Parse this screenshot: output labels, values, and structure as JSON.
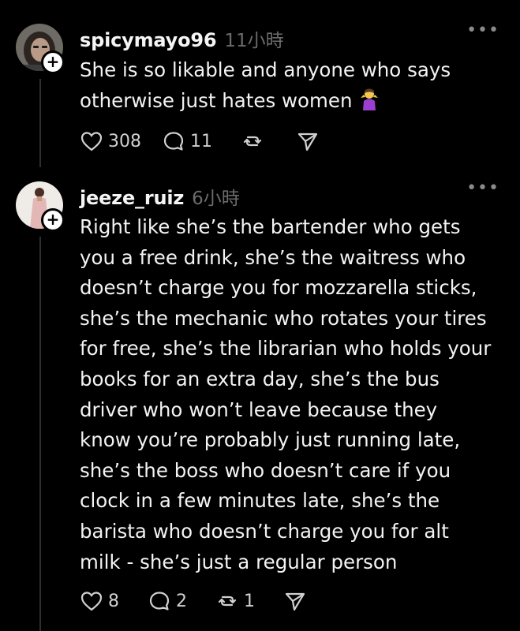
{
  "posts": [
    {
      "username": "spicymayo96",
      "timestamp": "11小時",
      "more_icon": "more-horizontal-icon",
      "text": "She is so likable and anyone who says\notherwise just hates women",
      "emoji": "person-shrugging-emoji",
      "actions": {
        "likes": "308",
        "replies": "11",
        "reposts": "",
        "share": ""
      }
    },
    {
      "username": "jeeze_ruiz",
      "timestamp": "6小時",
      "more_icon": "more-horizontal-icon",
      "text": "Right like she’s the bartender who gets\nyou a free drink, she’s the waitress who\ndoesn’t charge you for mozzarella sticks,\nshe’s the mechanic who  rotates your tires\nfor free, she’s the librarian who holds your\nbooks for an extra day, she’s the bus\ndriver who won’t leave because they\nknow you’re probably just running late,\nshe’s the boss who doesn’t care if you\nclock in a few minutes late, she’s the\nbarista who doesn’t charge you for alt\nmilk - she’s just a regular person",
      "actions": {
        "likes": "8",
        "replies": "2",
        "reposts": "1",
        "share": ""
      }
    }
  ],
  "icons": {
    "like": "heart-icon",
    "reply": "comment-icon",
    "repost": "repost-icon",
    "share": "send-icon",
    "follow": "plus-icon"
  },
  "colors": {
    "background": "#000000",
    "text": "#f3f3f3",
    "muted": "#6b6b6b"
  }
}
